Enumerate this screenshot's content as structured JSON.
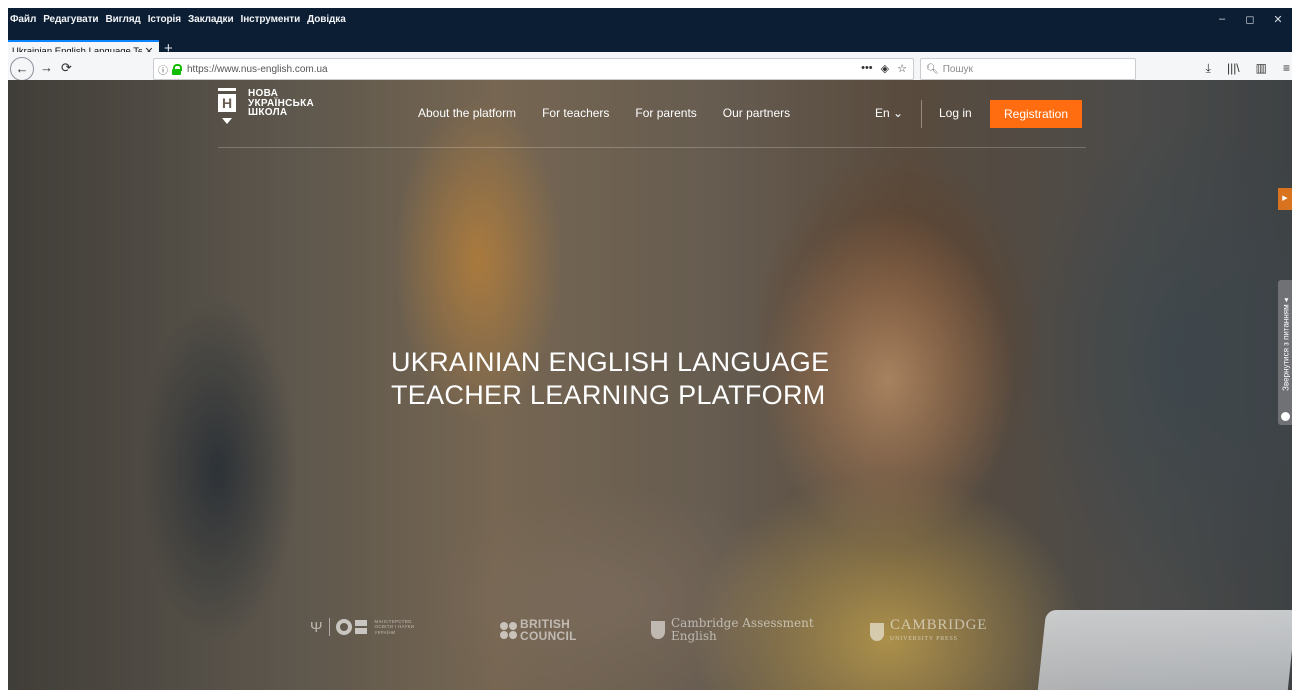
{
  "menubar": {
    "items": [
      "Файл",
      "Редагувати",
      "Вигляд",
      "Історія",
      "Закладки",
      "Інструменти",
      "Довідка"
    ]
  },
  "window_controls": {
    "minimize": "–",
    "restore": "◻",
    "close": "✕"
  },
  "tab": {
    "title": "Ukrainian English Language Teache",
    "close": "✕",
    "new_tab": "+"
  },
  "navbar": {
    "back": "←",
    "forward": "→",
    "reload": "⟳",
    "url": "https://www.nus-english.com.ua",
    "page_actions": [
      "•••",
      "◈",
      "☆"
    ],
    "search_placeholder": "Пошук",
    "toolbar_icons": [
      "⤓",
      "|||\\",
      "▥",
      "≡"
    ]
  },
  "site": {
    "logo_lines": [
      "НОВА",
      "УКРАЇНСЬКА",
      "ШКОЛА"
    ],
    "logo_letter": "Н",
    "nav": [
      "About the platform",
      "For teachers",
      "For parents",
      "Our partners"
    ],
    "language": "En ⌄",
    "login": "Log in",
    "registration": "Registration",
    "hero_title_line1": "UKRAINIAN ENGLISH LANGUAGE",
    "hero_title_line2": "TEACHER LEARNING PLATFORM",
    "feedback_tab": "Звернутися з питанням ◂",
    "partners": {
      "ministry_text": [
        "МІНІСТЕРСТВО",
        "ОСВІТИ І НАУКИ",
        "УКРАЇНИ"
      ],
      "british_council": [
        "BRITISH",
        "COUNCIL"
      ],
      "cambridge_assessment": [
        "Cambridge Assessment",
        "English"
      ],
      "cambridge_press": [
        "CAMBRIDGE",
        "UNIVERSITY PRESS"
      ]
    }
  }
}
